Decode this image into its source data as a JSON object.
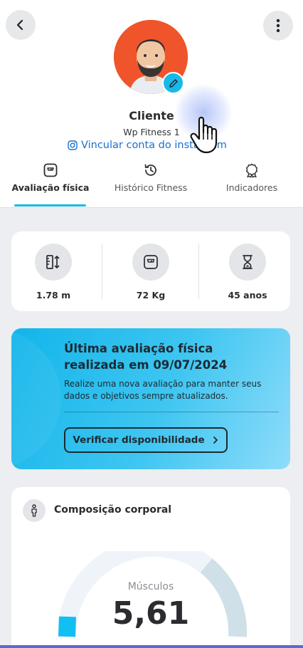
{
  "header": {
    "back_icon": "chevron-left-icon",
    "more_icon": "more-vertical-icon"
  },
  "profile": {
    "name": "Cliente",
    "gym": "Wp Fitness 1",
    "instagram_link": "Vincular conta do instagram",
    "edit_icon": "pencil-icon"
  },
  "tabs": [
    {
      "label": "Avaliação física",
      "icon": "scale-icon",
      "active": true
    },
    {
      "label": "Histórico Fitness",
      "icon": "history-icon",
      "active": false
    },
    {
      "label": "Indicadores",
      "icon": "award-icon",
      "active": false
    }
  ],
  "stats": [
    {
      "value": "1.78 m",
      "icon": "height-ruler-icon"
    },
    {
      "value": "72 Kg",
      "icon": "weight-scale-icon"
    },
    {
      "value": "45 anos",
      "icon": "hourglass-icon"
    }
  ],
  "promo": {
    "title": "Última avaliação física realizada em  09/07/2024",
    "text": "Realize uma nova avaliação para manter seus dados e objetivos sempre atualizados.",
    "button_label": "Verificar disponibilidade",
    "button_icon": "chevron-right-icon"
  },
  "composition": {
    "title": "Composição corporal",
    "icon": "person-icon",
    "gauge_label": "Músculos",
    "gauge_value": "5,61"
  },
  "colors": {
    "accent": "#17b9e8",
    "avatar_bg": "#f0542b",
    "link": "#1b6fd0"
  }
}
